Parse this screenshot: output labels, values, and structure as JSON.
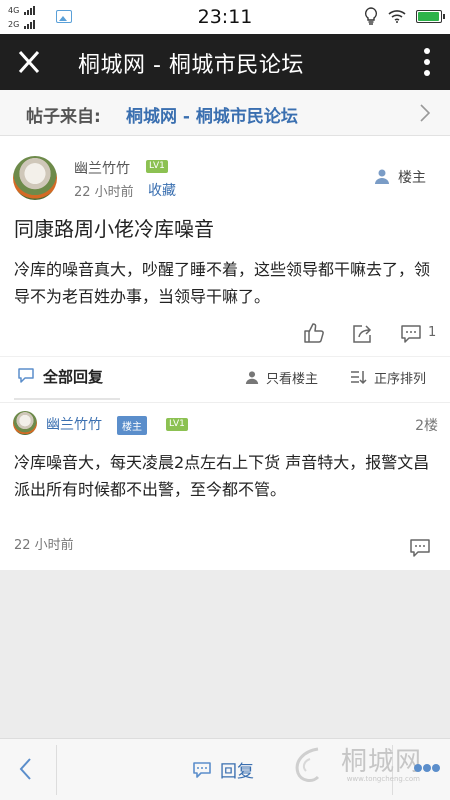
{
  "status_bar": {
    "net1": "4G",
    "net2": "2G",
    "time": "23:11",
    "battery_level": 0.95
  },
  "app_bar": {
    "title": "桐城网 - 桐城市民论坛"
  },
  "source": {
    "label": "帖子来自:",
    "forum": "桐城网 - 桐城市民论坛"
  },
  "post": {
    "author": "幽兰竹竹",
    "level": "LV1",
    "time": "22 小时前",
    "favorite": "收藏",
    "op_label": "楼主",
    "title": "同康路周小佬冷库噪音",
    "body": "冷库的噪音真大，吵醒了睡不着，这些领导都干嘛去了，领导不为老百姓办事，当领导干嘛了。",
    "comment_count": "1"
  },
  "tabs": {
    "all_replies": "全部回复",
    "op_only": "只看楼主",
    "sort": "正序排列"
  },
  "reply": {
    "author": "幽兰竹竹",
    "op_tag": "楼主",
    "level": "LV1",
    "floor": "2楼",
    "body": "冷库噪音大，每天凌晨2点左右上下货 声音特大，报警文昌派出所有时候都不出警，至今都不管。",
    "time": "22 小时前"
  },
  "bottom_bar": {
    "reply_label": "回复",
    "watermark": "桐城网",
    "watermark_url": "www.tongcheng.com"
  },
  "colors": {
    "app_bar_bg": "#1f1f1f",
    "link_blue": "#3a6fb0",
    "level_green": "#8cc152",
    "op_tag_blue": "#5b8ecb"
  },
  "icons": [
    "close-icon",
    "more-vertical-icon",
    "chevron-right-icon",
    "user-icon",
    "thumbs-up-icon",
    "share-icon",
    "comment-icon",
    "chat-icon",
    "sort-icon",
    "back-icon"
  ]
}
